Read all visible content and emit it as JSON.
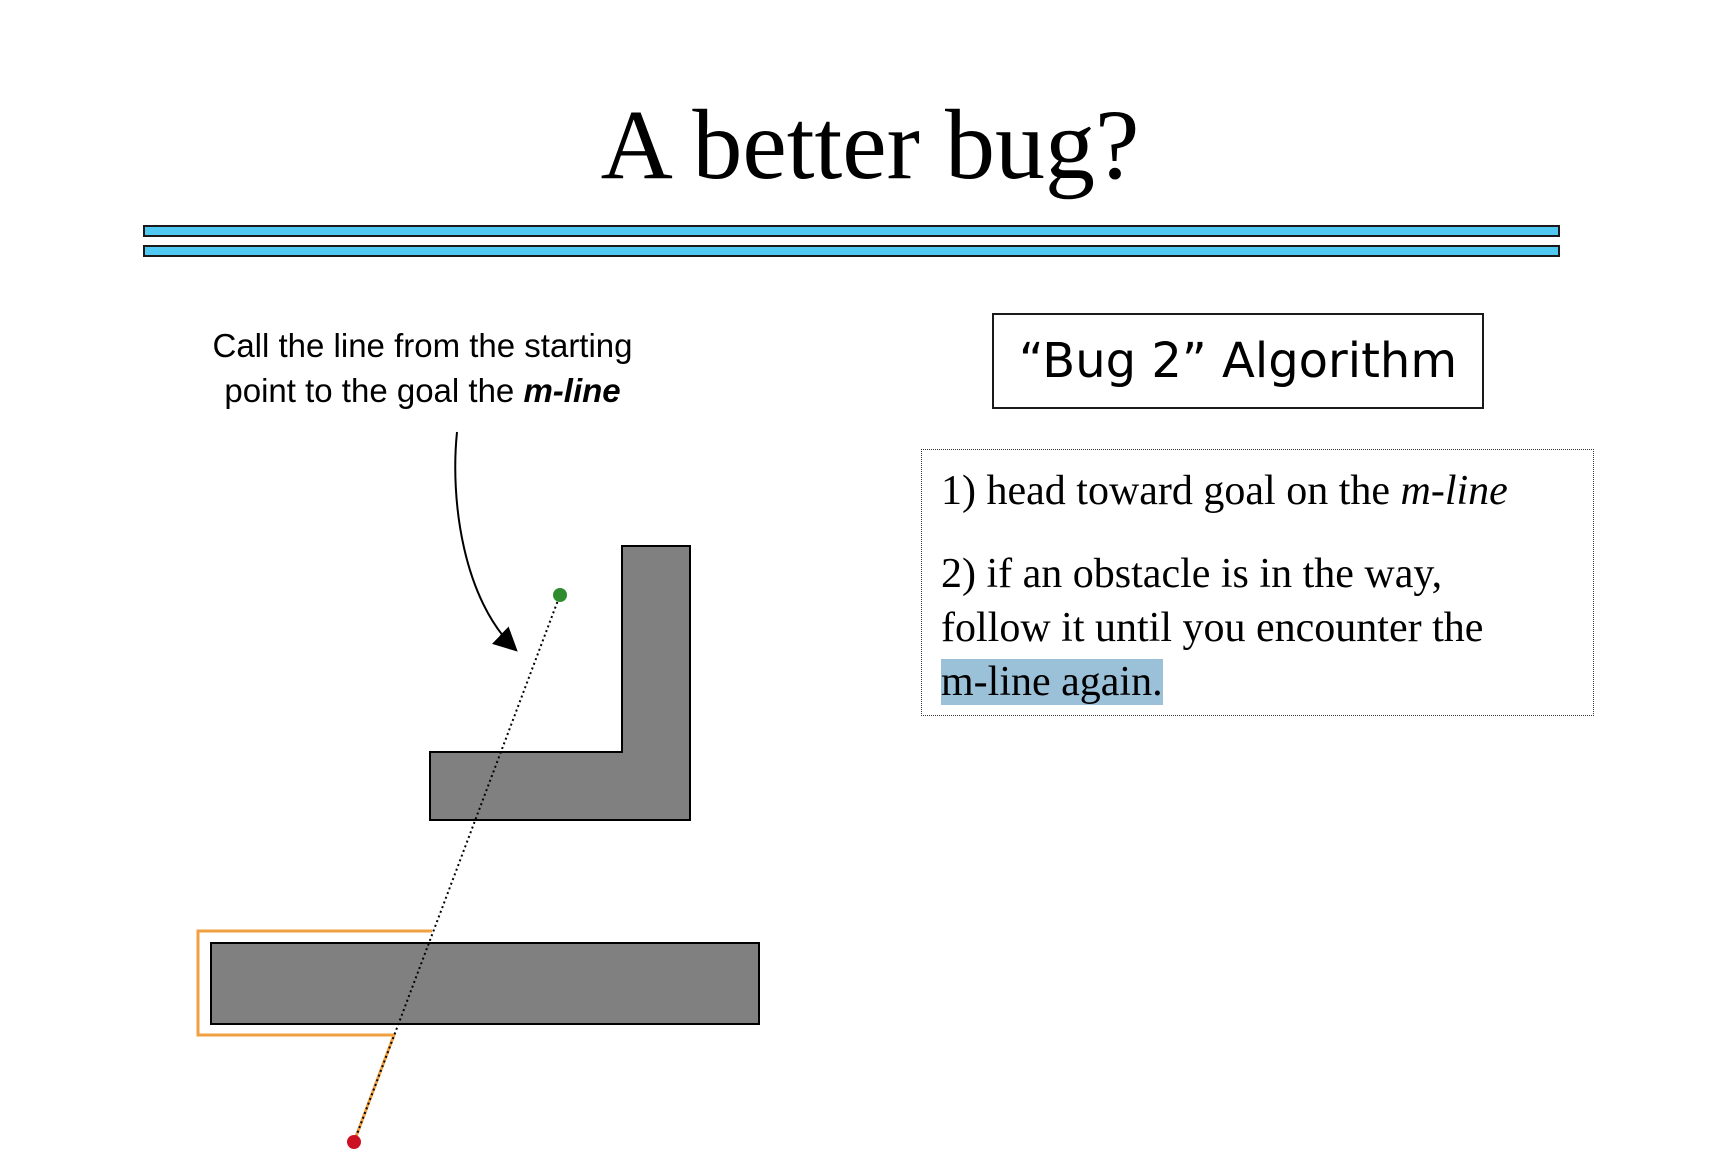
{
  "title": "A better bug?",
  "callout": {
    "line1": "Call the line from the starting",
    "line2_prefix": "point to the goal the ",
    "line2_emphasis": "m-line"
  },
  "algorithm": {
    "title": "“Bug 2” Algorithm",
    "step1_prefix": "1) head toward goal on the ",
    "step1_emphasis": "m-line",
    "step2_line1": "2) if an obstacle is in the way,",
    "step2_line2": "follow it until you encounter the",
    "step2_highlighted": "m-line again",
    "step2_end": "."
  },
  "colors": {
    "title_rule": "#4fc8f2",
    "obstacle_fill": "#808080",
    "path": "#f0a040",
    "goal": "#2e8b2e",
    "start": "#cc1122",
    "highlight": "#9bc1d9"
  },
  "icons": {
    "goal": "goal-point-icon",
    "start": "start-point-icon"
  }
}
